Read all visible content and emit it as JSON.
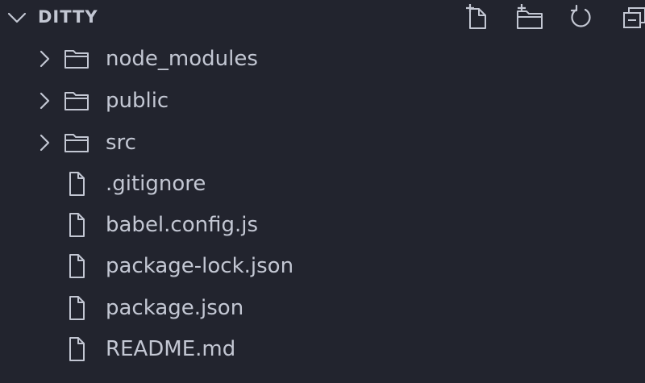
{
  "explorer": {
    "title": "DITTY",
    "actions": [
      {
        "icon": "new-file-icon"
      },
      {
        "icon": "new-folder-icon"
      },
      {
        "icon": "refresh-icon"
      },
      {
        "icon": "collapse-all-icon"
      }
    ],
    "items": [
      {
        "label": "node_modules",
        "type": "folder",
        "expanded": false
      },
      {
        "label": "public",
        "type": "folder",
        "expanded": false
      },
      {
        "label": "src",
        "type": "folder",
        "expanded": false
      },
      {
        "label": ".gitignore",
        "type": "file"
      },
      {
        "label": "babel.config.js",
        "type": "file"
      },
      {
        "label": "package-lock.json",
        "type": "file"
      },
      {
        "label": "package.json",
        "type": "file"
      },
      {
        "label": "README.md",
        "type": "file"
      }
    ]
  },
  "colors": {
    "background": "#22242e",
    "foreground": "#c3c7d3"
  }
}
